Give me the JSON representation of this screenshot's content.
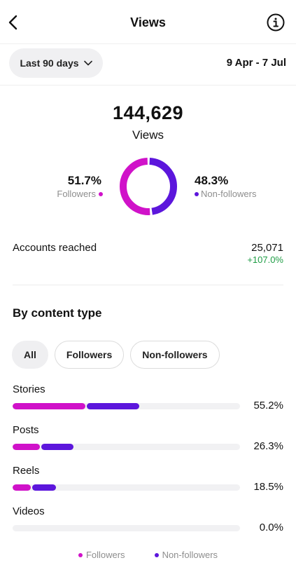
{
  "header": {
    "title": "Views",
    "back_icon": "chevron-left-icon",
    "info_icon": "info-circle-icon"
  },
  "range": {
    "selected": "Last 90 days",
    "date_range": "9 Apr - 7 Jul"
  },
  "summary": {
    "total": "144,629",
    "label": "Views",
    "followers_pct": "51.7%",
    "followers_label": "Followers",
    "followers_fraction": 0.517,
    "nonfollowers_pct": "48.3%",
    "nonfollowers_label": "Non-followers",
    "nonfollowers_fraction": 0.483
  },
  "accounts_reached": {
    "label": "Accounts reached",
    "value": "25,071",
    "change": "+107.0%"
  },
  "content_type": {
    "title": "By content type",
    "filters": [
      "All",
      "Followers",
      "Non-followers"
    ],
    "active_filter": "All",
    "rows": [
      {
        "label": "Stories",
        "pct": "55.2%",
        "followers_share": 0.32,
        "nonfollowers_share": 0.23
      },
      {
        "label": "Posts",
        "pct": "26.3%",
        "followers_share": 0.12,
        "nonfollowers_share": 0.14
      },
      {
        "label": "Reels",
        "pct": "18.5%",
        "followers_share": 0.08,
        "nonfollowers_share": 0.105
      },
      {
        "label": "Videos",
        "pct": "0.0%",
        "followers_share": 0,
        "nonfollowers_share": 0
      }
    ]
  },
  "legend": {
    "followers": "Followers",
    "nonfollowers": "Non-followers"
  },
  "colors": {
    "followers": "#d012c9",
    "nonfollowers": "#5c16dc",
    "positive": "#1f9d45"
  }
}
